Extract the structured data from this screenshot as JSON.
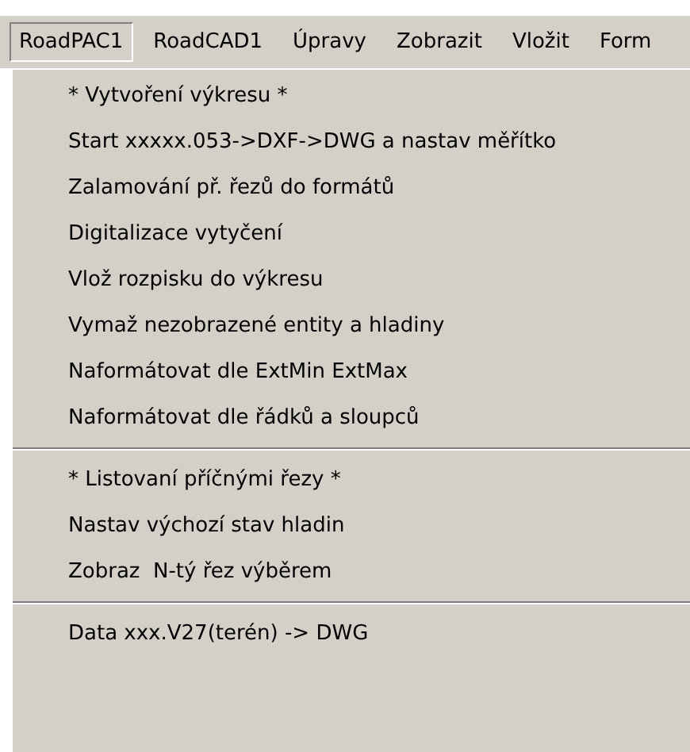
{
  "menu_bar": [
    {
      "label": "RoadPAC1",
      "selected": true
    },
    {
      "label": "RoadCAD1",
      "selected": false
    },
    {
      "label": "Úpravy",
      "selected": false
    },
    {
      "label": "Zobrazit",
      "selected": false
    },
    {
      "label": "Vložit",
      "selected": false
    },
    {
      "label": "Form",
      "selected": false
    }
  ],
  "dropdown": [
    {
      "kind": "item",
      "label": "* Vytvoření výkresu *"
    },
    {
      "kind": "item",
      "label": "Start xxxxx.053->DXF->DWG a nastav měřítko"
    },
    {
      "kind": "item",
      "label": "Zalamování př. řezů do formátů"
    },
    {
      "kind": "item",
      "label": "Digitalizace vytyčení"
    },
    {
      "kind": "item",
      "label": "Vlož rozpisku do výkresu"
    },
    {
      "kind": "item",
      "label": "Vymaž nezobrazené entity a hladiny"
    },
    {
      "kind": "item",
      "label": "Naformátovat dle ExtMin ExtMax"
    },
    {
      "kind": "item",
      "label": "Naformátovat dle řádků a sloupců"
    },
    {
      "kind": "separator"
    },
    {
      "kind": "item",
      "label": "* Listovaní příčnými řezy *"
    },
    {
      "kind": "item",
      "label": "Nastav výchozí stav hladin"
    },
    {
      "kind": "item",
      "label": "Zobraz  N-tý řez výběrem"
    },
    {
      "kind": "separator"
    },
    {
      "kind": "item",
      "label": "Data xxx.V27(terén) -> DWG"
    }
  ]
}
